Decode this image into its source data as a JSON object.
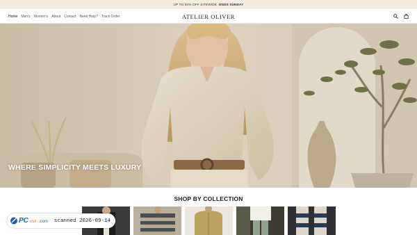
{
  "announcement": {
    "text": "UP TO 50% OFF SITEWIDE - ",
    "highlight": "ENDS SUNDAY"
  },
  "header": {
    "nav": [
      "Home",
      "Men's",
      "Women's",
      "About",
      "Contact",
      "Need Help?",
      "Track Order"
    ],
    "active": "Home",
    "logo": "ATELIER OLIVER",
    "icons": [
      "search-icon",
      "bag-icon"
    ]
  },
  "hero": {
    "title": "WHERE SIMPLICITY MEETS LUXURY"
  },
  "collection": {
    "title": "SHOP BY COLLECTION",
    "thumbnails": [
      "collection-thumb-1",
      "collection-thumb-2",
      "collection-thumb-3",
      "collection-thumb-4",
      "collection-thumb-5"
    ]
  },
  "watermark": {
    "logo_text": "PCrisk.com",
    "stamp": "scanned 2026-09-14"
  },
  "colors": {
    "announce_bg": "#f3ede2",
    "hero_bg": "#dcd0bd",
    "text": "#1a1a1a"
  }
}
